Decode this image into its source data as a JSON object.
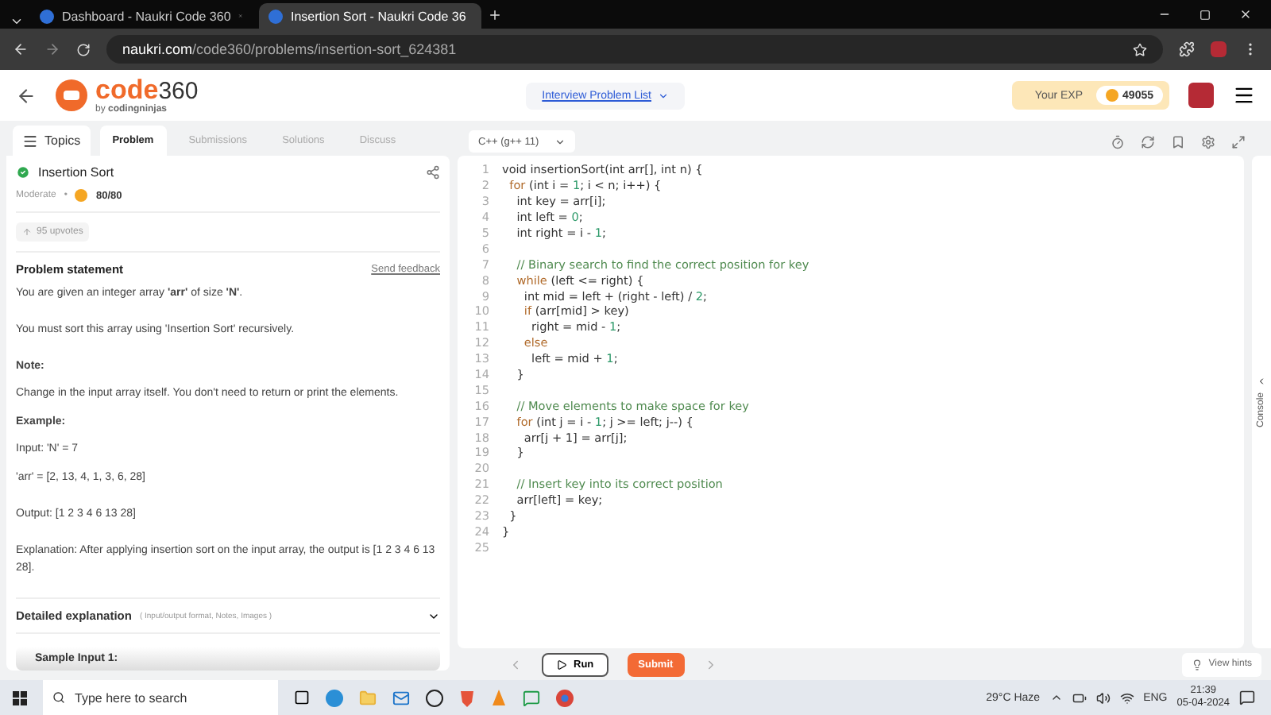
{
  "browser": {
    "tabs": [
      {
        "title": "Dashboard - Naukri Code 360",
        "selected": false
      },
      {
        "title": "Insertion Sort - Naukri Code 36",
        "selected": true
      }
    ],
    "url_host": "naukri.com",
    "url_path": "/code360/problems/insertion-sort_624381"
  },
  "header": {
    "logo_main": "code",
    "logo_num": "360",
    "logo_by": "by",
    "logo_brand": "codingninjas",
    "nav": "Interview Problem List",
    "exp_label": "Your EXP",
    "exp_value": "49055"
  },
  "panel_tabs": {
    "topics": "Topics",
    "tabs": [
      {
        "label": "Problem",
        "selected": true
      },
      {
        "label": "Submissions",
        "selected": false
      },
      {
        "label": "Solutions",
        "selected": false
      },
      {
        "label": "Discuss",
        "selected": false
      }
    ]
  },
  "language": "C++ (g++ 11)",
  "problem": {
    "title": "Insertion Sort",
    "solved": true,
    "difficulty": "Moderate",
    "separator": "•",
    "score": "80/80",
    "upvotes": "95 upvotes",
    "statement_heading": "Problem statement",
    "feedback": "Send feedback",
    "paragraphs": [
      {
        "kind": "text",
        "text": "You are given an integer array **'arr'** of size **'N'**."
      },
      {
        "kind": "text",
        "text": "You must sort this array using 'Insertion Sort' recursively."
      },
      {
        "kind": "heading",
        "text": "Note:"
      },
      {
        "kind": "tight",
        "text": "Change in the input array itself. You don't need to return or print the elements."
      },
      {
        "kind": "heading",
        "text": "Example:"
      },
      {
        "kind": "tight",
        "text": "Input: 'N' = 7"
      },
      {
        "kind": "text",
        "text": "'arr' = [2, 13, 4, 1, 3, 6, 28]"
      },
      {
        "kind": "text",
        "text": "Output: [1 2 3 4 6 13 28]"
      },
      {
        "kind": "text",
        "text": "Explanation: After applying insertion sort on the input array, the output is [1 2 3 4 6 13 28]."
      }
    ],
    "details_label": "Detailed explanation",
    "details_hint": "( Input/output format, Notes, Images )",
    "sample": "Sample Input 1:"
  },
  "code": [
    {
      "number": "1",
      "tokens": [
        {
          "kind": "plain",
          "text": "void insertionSort(int arr[], int n) {"
        }
      ]
    },
    {
      "number": "2",
      "tokens": [
        {
          "kind": "keyword",
          "text": "  for"
        },
        {
          "kind": "plain",
          "text": " (int i = "
        },
        {
          "kind": "number",
          "text": "1"
        },
        {
          "kind": "plain",
          "text": "; i < n; i++) {"
        }
      ]
    },
    {
      "number": "3",
      "tokens": [
        {
          "kind": "plain",
          "text": "    int key = arr[i];"
        }
      ]
    },
    {
      "number": "4",
      "tokens": [
        {
          "kind": "plain",
          "text": "    int left = "
        },
        {
          "kind": "number",
          "text": "0"
        },
        {
          "kind": "plain",
          "text": ";"
        }
      ]
    },
    {
      "number": "5",
      "tokens": [
        {
          "kind": "plain",
          "text": "    int right = i - "
        },
        {
          "kind": "number",
          "text": "1"
        },
        {
          "kind": "plain",
          "text": ";"
        }
      ]
    },
    {
      "number": "6"
    },
    {
      "number": "7",
      "tokens": [
        {
          "kind": "comment",
          "text": "    // Binary search to find the correct position for key"
        }
      ]
    },
    {
      "number": "8",
      "tokens": [
        {
          "kind": "keyword",
          "text": "    while"
        },
        {
          "kind": "plain",
          "text": " (left <= right) {"
        }
      ]
    },
    {
      "number": "9",
      "tokens": [
        {
          "kind": "plain",
          "text": "      int mid = left + (right - left) / "
        },
        {
          "kind": "number",
          "text": "2"
        },
        {
          "kind": "plain",
          "text": ";"
        }
      ]
    },
    {
      "number": "10",
      "tokens": [
        {
          "kind": "keyword",
          "text": "      if"
        },
        {
          "kind": "plain",
          "text": " (arr[mid] > key)"
        }
      ]
    },
    {
      "number": "11",
      "tokens": [
        {
          "kind": "plain",
          "text": "        right = mid - "
        },
        {
          "kind": "number",
          "text": "1"
        },
        {
          "kind": "plain",
          "text": ";"
        }
      ]
    },
    {
      "number": "12",
      "tokens": [
        {
          "kind": "keyword",
          "text": "      else"
        }
      ]
    },
    {
      "number": "13",
      "tokens": [
        {
          "kind": "plain",
          "text": "        left = mid + "
        },
        {
          "kind": "number",
          "text": "1"
        },
        {
          "kind": "plain",
          "text": ";"
        }
      ]
    },
    {
      "number": "14",
      "tokens": [
        {
          "kind": "plain",
          "text": "    }"
        }
      ]
    },
    {
      "number": "15"
    },
    {
      "number": "16",
      "tokens": [
        {
          "kind": "comment",
          "text": "    // Move elements to make space for key"
        }
      ]
    },
    {
      "number": "17",
      "tokens": [
        {
          "kind": "keyword",
          "text": "    for"
        },
        {
          "kind": "plain",
          "text": " (int j = i - "
        },
        {
          "kind": "number",
          "text": "1"
        },
        {
          "kind": "plain",
          "text": "; j >= left; j--) {"
        }
      ]
    },
    {
      "number": "18",
      "tokens": [
        {
          "kind": "plain",
          "text": "      arr[j + 1] = arr[j];"
        }
      ]
    },
    {
      "number": "19",
      "tokens": [
        {
          "kind": "plain",
          "text": "    }"
        }
      ]
    },
    {
      "number": "20"
    },
    {
      "number": "21",
      "tokens": [
        {
          "kind": "comment",
          "text": "    // Insert key into its correct position"
        }
      ]
    },
    {
      "number": "22",
      "tokens": [
        {
          "kind": "plain",
          "text": "    arr[left] = key;"
        }
      ]
    },
    {
      "number": "23",
      "tokens": [
        {
          "kind": "plain",
          "text": "  }"
        }
      ]
    },
    {
      "number": "24",
      "tokens": [
        {
          "kind": "plain",
          "text": "}"
        }
      ]
    },
    {
      "number": "25"
    }
  ],
  "console": "Console",
  "actions": {
    "run": "Run",
    "submit": "Submit",
    "hints": "View hints"
  },
  "taskbar": {
    "search_placeholder": "Type here to search",
    "weather": "29°C  Haze",
    "lang": "ENG",
    "time": "21:39",
    "date": "05-04-2024"
  }
}
